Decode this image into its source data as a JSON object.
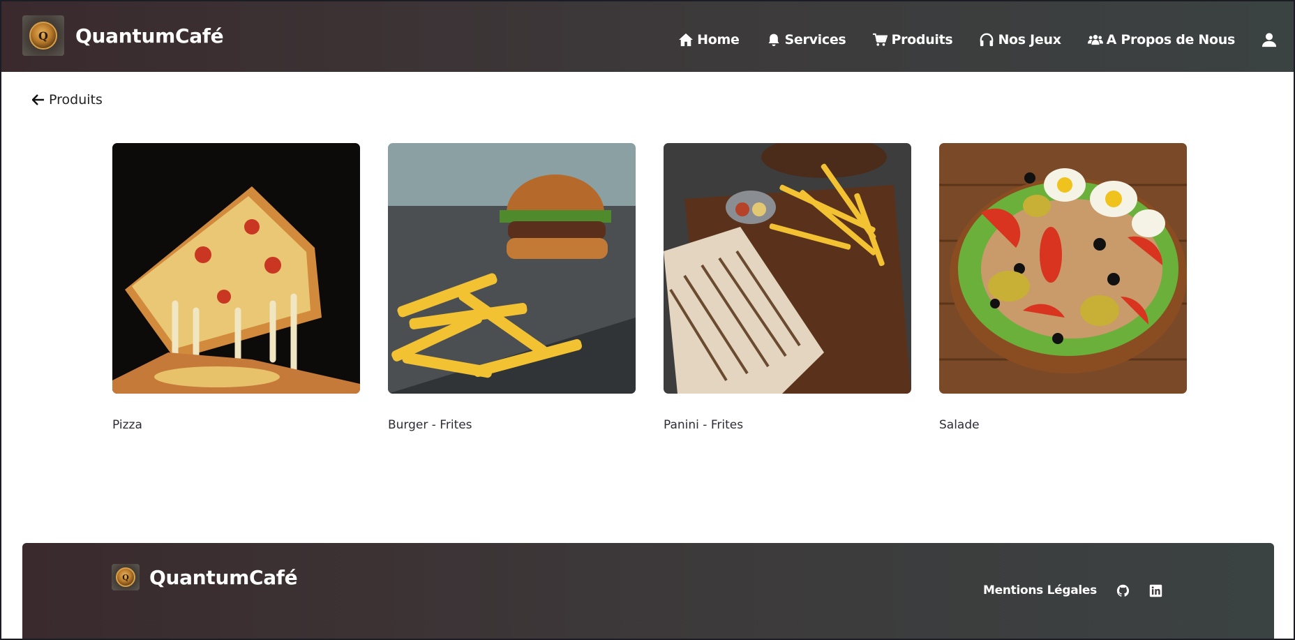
{
  "header": {
    "brand_name": "QuantumCafé",
    "nav": [
      {
        "label": "Home",
        "icon": "home-icon"
      },
      {
        "label": "Services",
        "icon": "bell-icon"
      },
      {
        "label": "Produits",
        "icon": "cart-icon"
      },
      {
        "label": "Nos Jeux",
        "icon": "headphones-icon"
      },
      {
        "label": "A Propos de Nous",
        "icon": "users-icon"
      }
    ],
    "user_icon": "user-icon"
  },
  "back_link": {
    "label": "Produits",
    "icon": "arrow-left-icon"
  },
  "products": [
    {
      "name": "Pizza"
    },
    {
      "name": "Burger - Frites"
    },
    {
      "name": "Panini - Frites"
    },
    {
      "name": "Salade"
    }
  ],
  "footer": {
    "brand_name": "QuantumCafé",
    "legal_link": "Mentions Légales",
    "social_icons": [
      "github-icon",
      "linkedin-icon"
    ]
  }
}
